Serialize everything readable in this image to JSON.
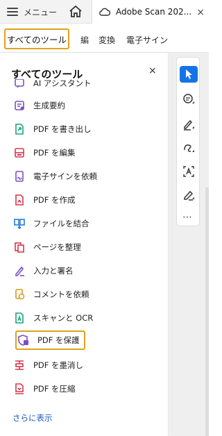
{
  "header": {
    "menu_label": "メニュー",
    "tab_title": "Adobe Scan 202...",
    "tab_close": "×"
  },
  "toolrow": {
    "all_tools": "すべてのツール",
    "edit_cut": "編",
    "menu_items": [
      "変換",
      "電子サイン"
    ]
  },
  "panel": {
    "title": "すべてのツール",
    "close": "×",
    "show_more": "さらに表示",
    "tools": [
      {
        "label": "AI アシスタント",
        "icon": "ai-assistant-icon",
        "color": "#7b4fc4"
      },
      {
        "label": "生成要約",
        "icon": "summary-icon",
        "color": "#7b4fc4"
      },
      {
        "label": "PDF を書き出し",
        "icon": "export-pdf-icon",
        "color": "#1aa37a"
      },
      {
        "label": "PDF を編集",
        "icon": "edit-pdf-icon",
        "color": "#d6364d"
      },
      {
        "label": "電子サインを依頼",
        "icon": "request-signature-icon",
        "color": "#7b4fc4"
      },
      {
        "label": "PDF を作成",
        "icon": "create-pdf-icon",
        "color": "#d6364d"
      },
      {
        "label": "ファイルを結合",
        "icon": "combine-files-icon",
        "color": "#1a73d6"
      },
      {
        "label": "ページを整理",
        "icon": "organize-pages-icon",
        "color": "#d6364d"
      },
      {
        "label": "入力と署名",
        "icon": "fill-sign-icon",
        "color": "#7b4fc4"
      },
      {
        "label": "コメントを依頼",
        "icon": "request-comment-icon",
        "color": "#d99a12"
      },
      {
        "label": "スキャンと OCR",
        "icon": "scan-ocr-icon",
        "color": "#1aa37a"
      },
      {
        "label": "PDF を保護",
        "icon": "protect-pdf-icon",
        "color": "#7b4fc4"
      },
      {
        "label": "PDF を墨消し",
        "icon": "redact-pdf-icon",
        "color": "#d6364d"
      },
      {
        "label": "PDF を圧縮",
        "icon": "compress-pdf-icon",
        "color": "#d6364d"
      }
    ]
  },
  "toolbar": {
    "items": [
      "select-cursor-icon",
      "add-comment-icon",
      "highlight-pen-icon",
      "draw-freehand-icon",
      "text-recognition-icon",
      "fill-sign-pen-icon"
    ],
    "more": "⋯"
  },
  "colors": {
    "accent": "#1473e6",
    "focus_outline": "#e0a11b",
    "link": "#1a56c5"
  }
}
